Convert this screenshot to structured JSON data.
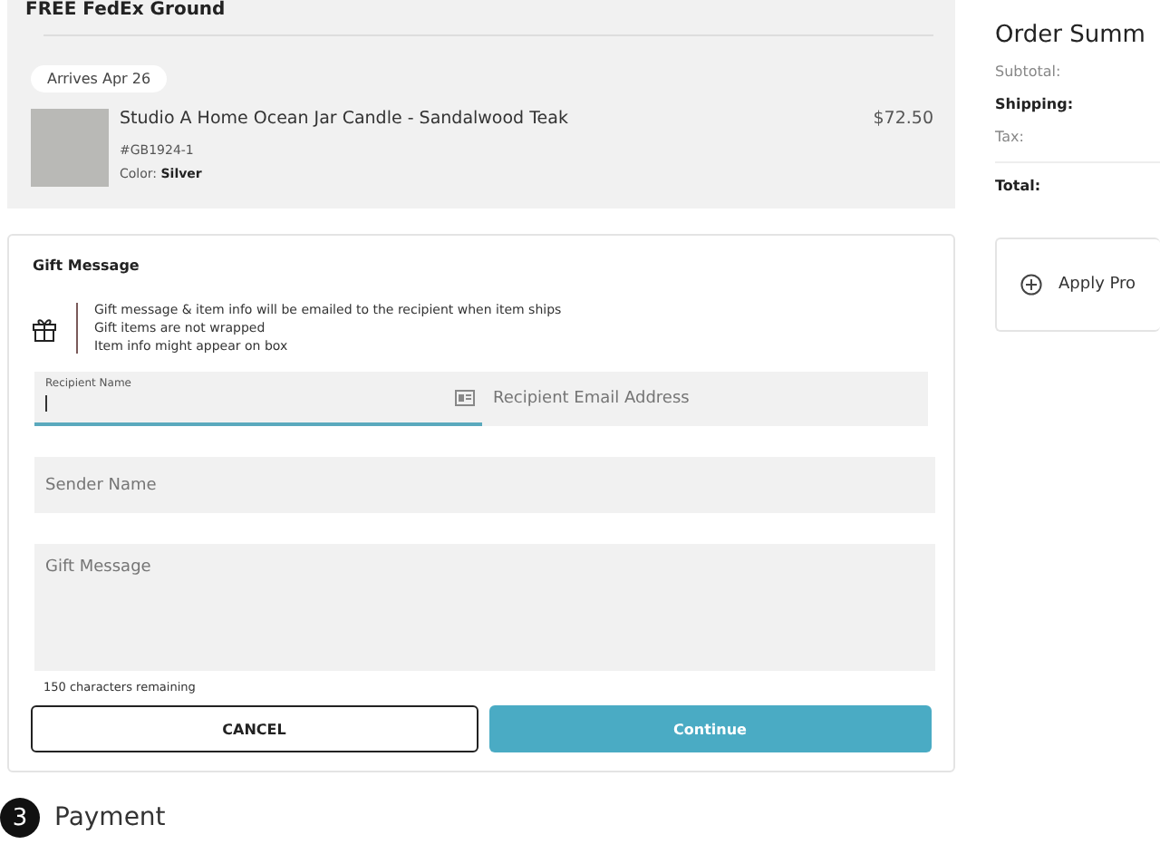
{
  "shipment": {
    "method": "FREE FedEx Ground",
    "arrival": "Arrives Apr 26",
    "item": {
      "name": "Studio A Home Ocean Jar Candle - Sandalwood Teak",
      "sku": "#GB1924-1",
      "color_label": "Color:",
      "color_value": "Silver",
      "price": "$72.50"
    }
  },
  "gift_message": {
    "title": "Gift Message",
    "notes": [
      "Gift message & item info will be emailed to the recipient when item ships",
      "Gift items are not wrapped",
      "Item info might appear on box"
    ],
    "fields": [
      {
        "kind": "floating",
        "label": "Recipient Name",
        "focused": true
      },
      {
        "kind": "plain",
        "placeholder": "Recipient Email Address",
        "focused": false
      },
      {
        "kind": "wide",
        "placeholder": "Sender Name",
        "focused": false
      },
      {
        "kind": "area",
        "placeholder": "Gift Message",
        "focused": false
      }
    ],
    "remaining": "150 characters remaining",
    "buttons": [
      {
        "kind": "outline",
        "label": "CANCEL"
      },
      {
        "kind": "primary",
        "label": "Continue"
      }
    ]
  },
  "next_step": {
    "number": "3",
    "title": "Payment"
  },
  "order_summary": {
    "title": "Order Summ",
    "lines": [
      {
        "label": "Subtotal:",
        "bold": false
      },
      {
        "label": "Shipping:",
        "bold": true
      },
      {
        "label": "Tax:",
        "bold": false
      }
    ],
    "total": "Total:",
    "promo": "Apply Pro"
  }
}
